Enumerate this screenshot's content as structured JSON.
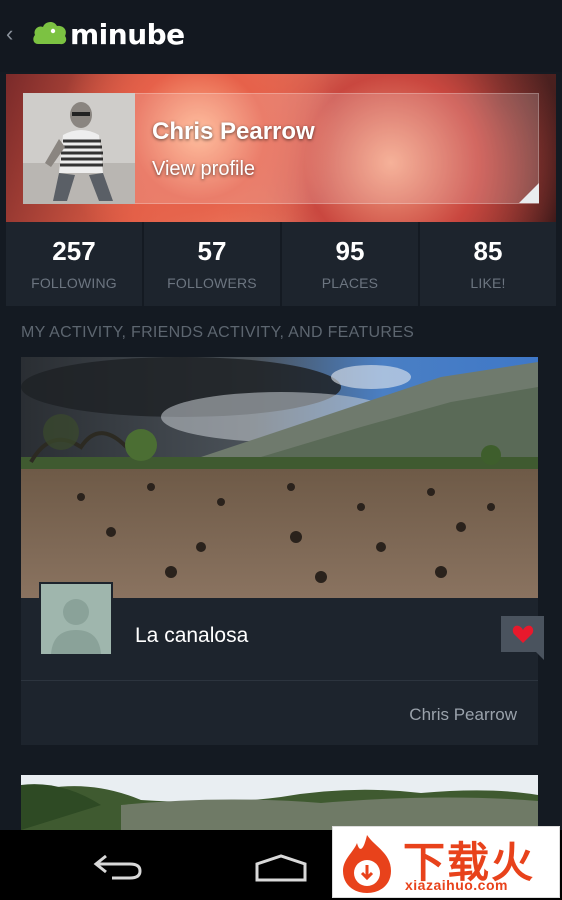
{
  "app": {
    "back_glyph": "‹",
    "logo_text": "minube",
    "logo_color": "#7cc242"
  },
  "profile": {
    "name": "Chris Pearrow",
    "link_label": "View profile"
  },
  "stats": [
    {
      "value": "257",
      "label": "FOLLOWING"
    },
    {
      "value": "57",
      "label": "FOLLOWERS"
    },
    {
      "value": "95",
      "label": "PLACES"
    },
    {
      "value": "85",
      "label": "LIKE!"
    }
  ],
  "activity": {
    "section_title": "MY ACTIVITY, FRIENDS ACTIVITY, AND FEATURES",
    "cards": [
      {
        "place_name": "La canalosa",
        "author": "Chris Pearrow",
        "like_icon": "heart-icon",
        "like_color": "#e8192c"
      }
    ]
  },
  "navbar": {
    "icons": [
      "back-icon",
      "home-icon"
    ]
  },
  "watermark": {
    "cn_text": "下载火",
    "url": "xiazaihuo.com",
    "color": "#e8421b"
  }
}
